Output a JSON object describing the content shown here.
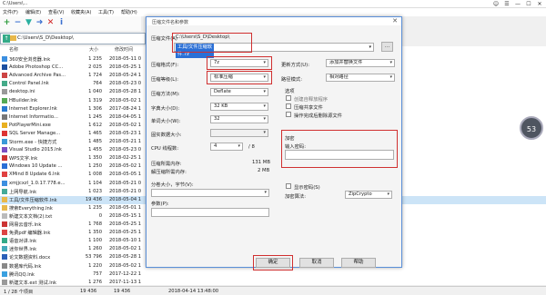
{
  "window": {
    "title": "C:\\Users\\...",
    "buttons": [
      "☺",
      "☰",
      "—",
      "☐",
      "✕"
    ]
  },
  "menu": [
    "文件(F)",
    "编辑(E)",
    "查看(V)",
    "收藏夹(A)",
    "工具(T)",
    "帮助(H)"
  ],
  "toolbar_icons": [
    "+",
    "−",
    "▼",
    "➜",
    "✕",
    "i"
  ],
  "path": "C:\\Users\\S_D\\Desktop\\",
  "columns": {
    "name": "名称",
    "size": "大小",
    "date": "修改时间"
  },
  "files": [
    {
      "name": "360安全浏览器.lnk",
      "size": "1 235",
      "date": "2018-05-11 0",
      "icon": "#3b8fe0"
    },
    {
      "name": "Adobe Photoshop CC...",
      "size": "2 025",
      "date": "2018-05-25 1",
      "icon": "#1a4fa0"
    },
    {
      "name": "Advanced Archive Pas...",
      "size": "1 724",
      "date": "2018-05-24 1",
      "icon": "#c44"
    },
    {
      "name": "Control Panel.lnk",
      "size": "764",
      "date": "2018-05-23 0",
      "icon": "#4a8"
    },
    {
      "name": "desktop.ini",
      "size": "1 040",
      "date": "2018-05-28 1",
      "icon": "#999"
    },
    {
      "name": "HBuilder.lnk",
      "size": "1 319",
      "date": "2018-05-02 1",
      "icon": "#5a5"
    },
    {
      "name": "Internet Explorer.lnk",
      "size": "1 306",
      "date": "2017-08-24 1",
      "icon": "#2a7ad0"
    },
    {
      "name": "Internet Informatio...",
      "size": "1 245",
      "date": "2018-04-05 1",
      "icon": "#777"
    },
    {
      "name": "PotPlayerMini.exe",
      "size": "1 612",
      "date": "2018-05-02 1",
      "icon": "#e8b020"
    },
    {
      "name": "SQL Server Manage...",
      "size": "1 465",
      "date": "2018-05-23 1",
      "icon": "#d33"
    },
    {
      "name": "Storm.exe - 快捷方式",
      "size": "1 485",
      "date": "2018-05-21 1",
      "icon": "#3a9ad8"
    },
    {
      "name": "Visual Studio 2015.lnk",
      "size": "1 455",
      "date": "2018-05-23 0",
      "icon": "#7a4fc4"
    },
    {
      "name": "WPS文字.lnk",
      "size": "1 350",
      "date": "2018-02-25 1",
      "icon": "#c33"
    },
    {
      "name": "Windows 10 Update ...",
      "size": "1 250",
      "date": "2018-05-02 1",
      "icon": "#2a6fd6"
    },
    {
      "name": "XMind 8 Update 6.lnk",
      "size": "1 008",
      "date": "2018-05-05 1",
      "icon": "#e04040"
    },
    {
      "name": "xmjjcxzl_1.0.17.778.e...",
      "size": "1 104",
      "date": "2018-05-21 0",
      "icon": "#3b8fe0"
    },
    {
      "name": "上网导航.lnk",
      "size": "1 023",
      "date": "2018-05-21 0",
      "icon": "#4a9"
    },
    {
      "name": "工具/文件压缩软件.lnk",
      "size": "19 436",
      "date": "2018-05-04 1",
      "icon": "#e8b84a"
    },
    {
      "name": "搜索Everything.lnk",
      "size": "1 235",
      "date": "2018-05-01 1",
      "icon": "#e8b84a"
    },
    {
      "name": "新建文本文档(2).txt",
      "size": "0",
      "date": "2018-05-15 1",
      "icon": "#bbb"
    },
    {
      "name": "网易云音乐.lnk",
      "size": "1 768",
      "date": "2018-05-25 1",
      "icon": "#c33"
    },
    {
      "name": "免费pdf 编辑器.lnk",
      "size": "1 350",
      "date": "2018-05-25 1",
      "icon": "#d44"
    },
    {
      "name": "语音对讲.lnk",
      "size": "1 100",
      "date": "2018-05-10 1",
      "icon": "#3a8"
    },
    {
      "name": "迷你世界.lnk",
      "size": "1 260",
      "date": "2018-05-02 1",
      "icon": "#4ab"
    },
    {
      "name": "论文数据资料.docx",
      "size": "53 796",
      "date": "2018-05-28 1",
      "icon": "#2a5fb8"
    },
    {
      "name": "数据库代码.lnk",
      "size": "1 220",
      "date": "2018-05-02 1",
      "icon": "#888"
    },
    {
      "name": "腾讯QQ.lnk",
      "size": "757",
      "date": "2017-12-22 1",
      "icon": "#3aa0e0"
    },
    {
      "name": "新建文本.ext 测试.lnk",
      "size": "1 276",
      "date": "2017-11-13 1",
      "icon": "#999"
    }
  ],
  "status": {
    "selection": "1 / 28 个项目",
    "size1": "19 436",
    "size2": "19 436",
    "date": "2018-04-14 13:48:00"
  },
  "badge": "53",
  "dialog": {
    "title": "压缩文件名和参数",
    "archive_label": "压缩文件(A)",
    "archive_path": "C:\\Users\\S_D\\Desktop\\",
    "archive_name": "工具/文件压缩软件.7z",
    "browse": "...",
    "format_label": "压缩格式(F):",
    "format_value": "7z",
    "level_label": "压缩等级(L):",
    "level_value": "标准压缩",
    "method_label": "压缩方法(M):",
    "method_value": "Deflate",
    "dict_label": "字典大小(D):",
    "dict_value": "32 KB",
    "word_label": "单词大小(W):",
    "word_value": "32",
    "solid_label": "固实数据大小:",
    "solid_value": "",
    "cpu_label": "CPU 线程数:",
    "cpu_value": "4",
    "cpu_total": "/ 8",
    "mem_comp_label": "压缩所需内存:",
    "mem_comp_value": "131 MB",
    "mem_decomp_label": "解压缩所需内存:",
    "mem_decomp_value": "2 MB",
    "split_label": "分卷大小，字节(V):",
    "params_label": "参数(P):",
    "update_label": "更新方式(U):",
    "update_value": "添加并替换文件",
    "path_mode_label": "路径模式:",
    "path_mode_value": "相对路径",
    "options_label": "选项",
    "opt1": "创建自释放程序",
    "opt2": "压缩共享文件",
    "opt3": "操作完成后删除源文件",
    "encrypt_label": "加密",
    "password_label": "输入密码:",
    "show_password": "显示密码(S)",
    "encrypt_method_label": "加密算法:",
    "encrypt_method_value": "ZipCrypto",
    "ok": "确定",
    "cancel": "取消",
    "help": "帮助"
  }
}
